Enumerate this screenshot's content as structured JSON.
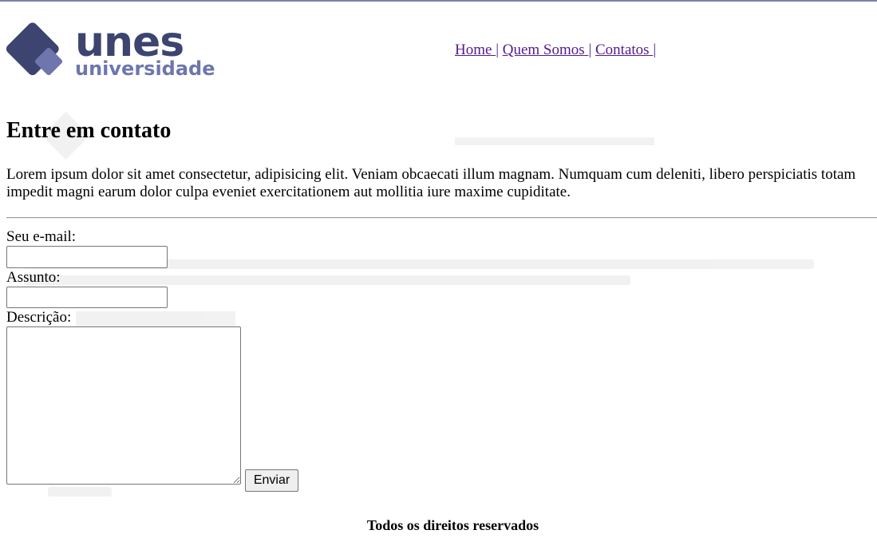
{
  "brand": {
    "name": "unes",
    "subtitle": "universidade",
    "primary_color": "#3d4470",
    "accent_color": "#6e76ad"
  },
  "nav": {
    "items": [
      {
        "label": "Home "
      },
      {
        "label": "Quem Somos "
      },
      {
        "label": "Contatos "
      }
    ],
    "separator": "|",
    "link_color": "#551a8b"
  },
  "content": {
    "heading": "Entre em contato",
    "intro": "Lorem ipsum dolor sit amet consectetur, adipisicing elit. Veniam obcaecati illum magnam. Numquam cum deleniti, libero perspiciatis totam impedit magni earum dolor culpa eveniet exercitationem aut mollitia iure maxime cupiditate."
  },
  "form": {
    "email_label": "Seu e-mail:",
    "email_value": "",
    "subject_label": "Assunto:",
    "subject_value": "",
    "description_label": "Descrição:",
    "description_value": "",
    "submit_label": "Enviar"
  },
  "footer": {
    "text": "Todos os direitos reservados"
  }
}
